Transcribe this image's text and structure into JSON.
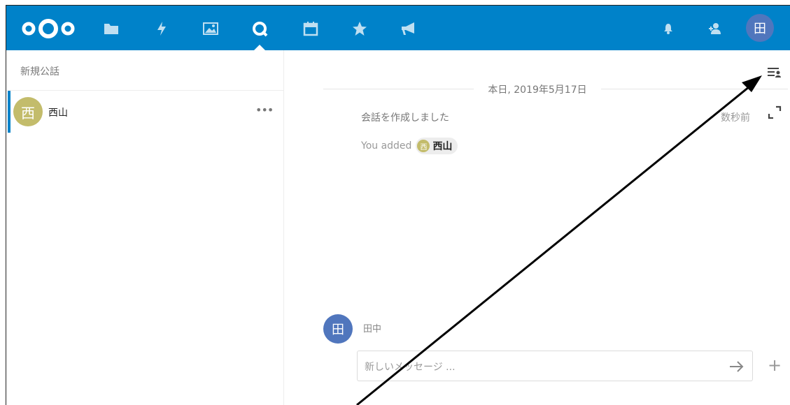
{
  "header": {
    "nav": [
      {
        "icon": "folder-icon",
        "label": "Files"
      },
      {
        "icon": "activity-icon",
        "label": "Activity"
      },
      {
        "icon": "gallery-icon",
        "label": "Gallery"
      },
      {
        "icon": "talk-icon",
        "label": "Talk",
        "active": true
      },
      {
        "icon": "calendar-icon",
        "label": "Calendar"
      },
      {
        "icon": "star-icon",
        "label": "Favorites"
      },
      {
        "icon": "megaphone-icon",
        "label": "Announcements"
      }
    ],
    "user_avatar_text": "田"
  },
  "sidebar": {
    "new_conversation_placeholder": "新規公話",
    "conversations": [
      {
        "avatar_text": "西",
        "name": "西山",
        "more": "•••"
      }
    ]
  },
  "main": {
    "date_separator": "本日, 2019年5月17日",
    "system_message": "会話を作成しました",
    "system_time": "数秒前",
    "added_prefix": "You added",
    "added_user": {
      "avatar_text": "西",
      "name": "西山"
    },
    "current_user": {
      "avatar_text": "田",
      "name": "田中"
    },
    "message_input_placeholder": "新しいメッセージ ..."
  },
  "colors": {
    "header_bg": "#0082c9",
    "conv_avatar": "#c3bc6b",
    "user_avatar": "#5076bd"
  }
}
